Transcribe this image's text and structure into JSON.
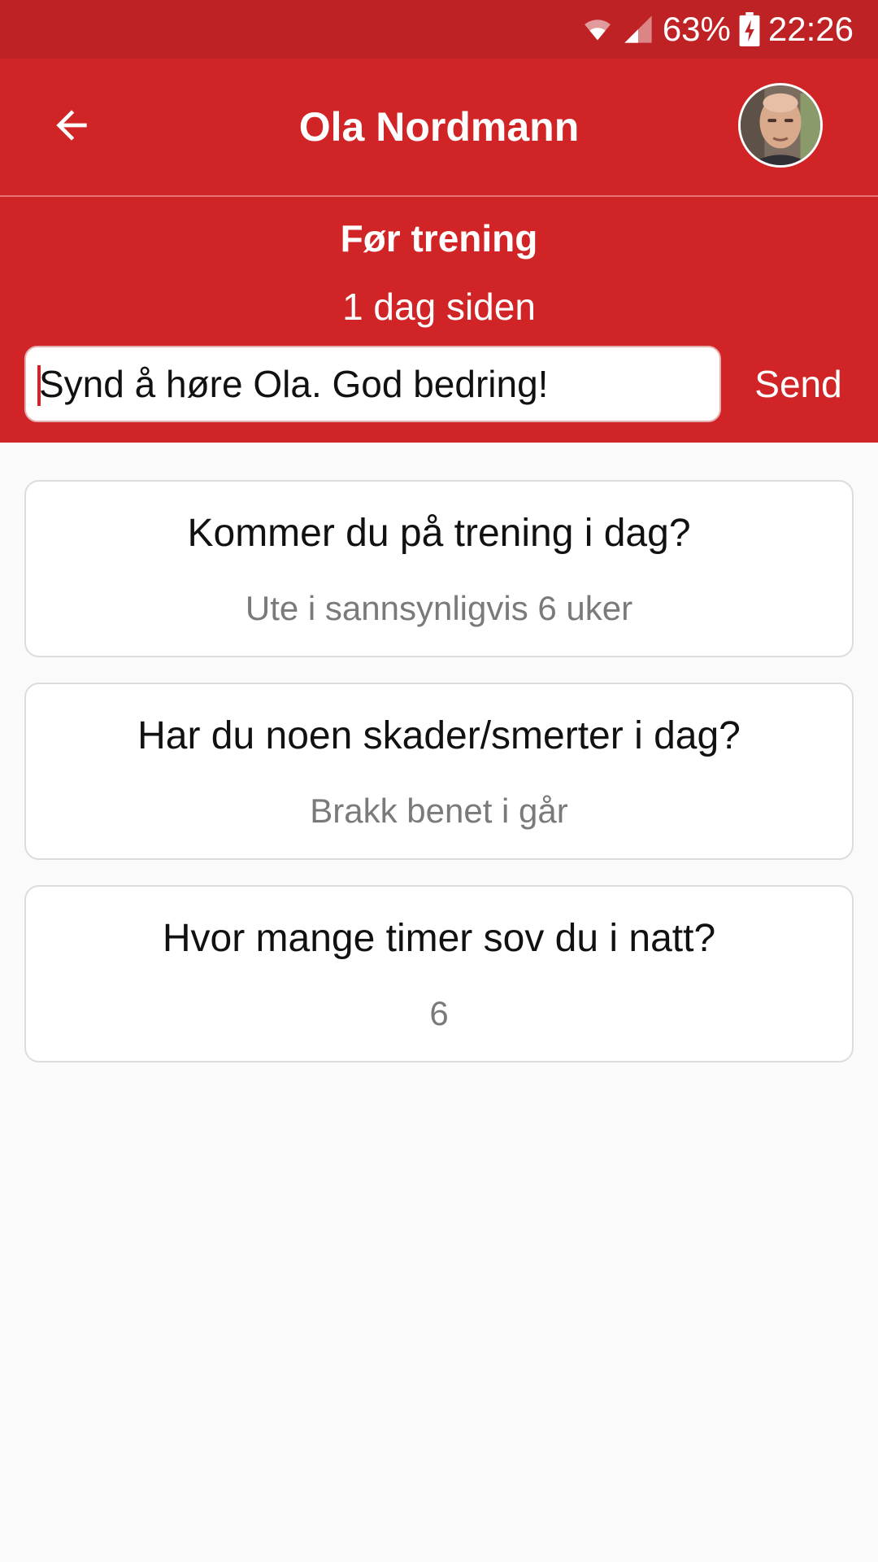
{
  "status_bar": {
    "battery": "63%",
    "time": "22:26",
    "icons": [
      "wifi-icon",
      "signal-icon",
      "battery-charging-icon"
    ]
  },
  "app_bar": {
    "title": "Ola Nordmann",
    "back_icon": "arrow-left-icon",
    "avatar": "user-avatar"
  },
  "session": {
    "title": "Før trening",
    "time_ago": "1 dag siden"
  },
  "comment": {
    "value": "Synd å høre Ola. God bedring!",
    "send_label": "Send"
  },
  "cards": [
    {
      "question": "Kommer du på trening i dag?",
      "answer": "Ute i sannsynligvis 6 uker"
    },
    {
      "question": "Har du noen skader/smerter i dag?",
      "answer": "Brakk benet i går"
    },
    {
      "question": "Hvor mange timer sov du i natt?",
      "answer": "6"
    }
  ],
  "colors": {
    "primary": "#d12426",
    "status_bar": "#bf2224",
    "background": "#fafafa"
  }
}
